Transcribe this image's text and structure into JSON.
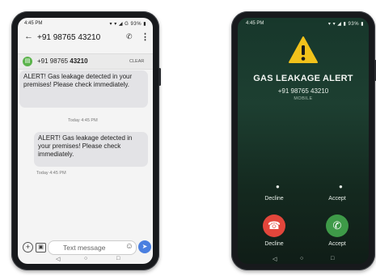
{
  "sms": {
    "status_time": "4:45 PM",
    "status_icons": "▾ ▾ ◢ G 93% ▮",
    "back_icon": "←",
    "contact": "+91 98765 43210",
    "call_icon": "✆",
    "more_icon": "⋮",
    "sender_badge": "▤",
    "sender_prefix": "+91 98765 ",
    "sender_bold": "43210",
    "clear_label": "CLEAR",
    "messages": [
      {
        "text": "ALERT! Gas leakage detected in your premises! Please check immediately.",
        "time": "Today 4:45 PM"
      },
      {
        "text": "ALERT! Gas leakage detected in your premises! Please check immediately.",
        "time": "Today 4:45 PM"
      }
    ],
    "compose": {
      "add_icon": "+",
      "gallery_icon": "▣",
      "placeholder": "Text message",
      "emoji_icon": "☺",
      "send_icon": "➤"
    },
    "nav": {
      "back": "◁",
      "home": "○",
      "recents": "□"
    }
  },
  "call": {
    "status_time": "4:45 PM",
    "status_icons": "▾ ▾ ◢ ▮ 93% ▮",
    "title": "GAS LEAKAGE ALERT",
    "number": "+91 98765 43210",
    "subtitle": "MOBILE",
    "decline_small_icon": "●",
    "accept_small_icon": "●",
    "decline_label": "Decline",
    "accept_label": "Accept",
    "decline_icon": "☎",
    "accept_icon": "✆",
    "decline_button_label": "Decline",
    "accept_button_label": "Accept",
    "colors": {
      "decline": "#e2463b",
      "accept": "#3e9a48",
      "warning": "#f2c21b"
    },
    "nav": {
      "back": "◁",
      "home": "○",
      "recents": "□"
    }
  }
}
